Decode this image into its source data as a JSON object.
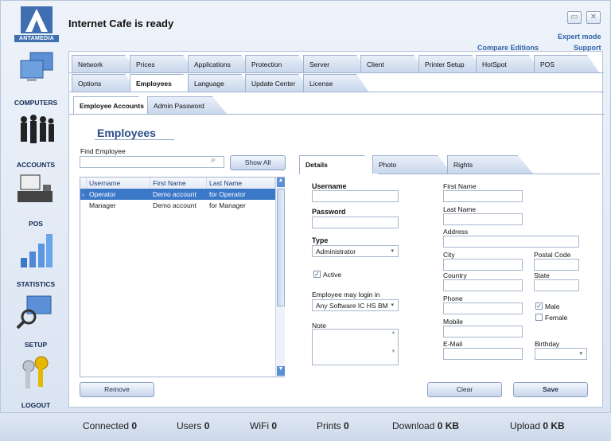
{
  "app": {
    "title": "Internet Cafe is ready",
    "brand": "ANTAMEDIA",
    "expert_mode": "Expert mode",
    "compare": "Compare Editions",
    "support": "Support",
    "min_icon": "minimize-icon",
    "close_icon": "close-icon"
  },
  "sidebar": {
    "items": [
      {
        "label": "COMPUTERS",
        "icon": "computers-icon"
      },
      {
        "label": "ACCOUNTS",
        "icon": "accounts-icon"
      },
      {
        "label": "POS",
        "icon": "pos-icon"
      },
      {
        "label": "STATISTICS",
        "icon": "statistics-icon"
      },
      {
        "label": "SETUP",
        "icon": "setup-icon"
      },
      {
        "label": "LOGOUT",
        "icon": "logout-icon"
      }
    ]
  },
  "tabs_row1": [
    "Network",
    "Prices",
    "Applications",
    "Protection",
    "Server",
    "Client",
    "Printer Setup",
    "HotSpot",
    "POS"
  ],
  "tabs_row2": [
    "Options",
    "Employees",
    "Language",
    "Update Center",
    "License"
  ],
  "subtabs": [
    "Employee Accounts",
    "Admin Password"
  ],
  "employees": {
    "heading": "Employees",
    "find_label": "Find Employee",
    "find_value": "",
    "show_all": "Show All",
    "columns": [
      "Username",
      "First Name",
      "Last Name"
    ],
    "rows": [
      [
        "Operator",
        "Demo account",
        "for Operator"
      ],
      [
        "Manager",
        "Demo account",
        "for Manager"
      ]
    ],
    "remove": "Remove"
  },
  "detail_tabs": [
    "Details",
    "Photo",
    "Rights"
  ],
  "details": {
    "username_label": "Username",
    "username_value": "",
    "password_label": "Password",
    "password_value": "",
    "type_label": "Type",
    "type_value": "Administrator",
    "active_label": "Active",
    "active_checked": true,
    "login_label": "Employee may login in",
    "login_value": "Any Software IC HS BM",
    "note_label": "Note",
    "note_value": "",
    "first_name": "First Name",
    "last_name": "Last Name",
    "address": "Address",
    "city": "City",
    "postal_code": "Postal Code",
    "country": "Country",
    "state": "State",
    "phone": "Phone",
    "mobile": "Mobile",
    "email": "E-Mail",
    "birthday": "Birthday",
    "male": "Male",
    "female": "Female",
    "male_checked": true,
    "female_checked": false,
    "clear": "Clear",
    "save": "Save"
  },
  "status": {
    "connected_label": "Connected",
    "connected": "0",
    "users_label": "Users",
    "users": "0",
    "wifi_label": "WiFi",
    "wifi": "0",
    "prints_label": "Prints",
    "prints": "0",
    "download_label": "Download",
    "download": "0 KB",
    "upload_label": "Upload",
    "upload": "0 KB"
  },
  "colors": {
    "accent": "#2f63a8",
    "selected_row": "#3c78c8"
  }
}
